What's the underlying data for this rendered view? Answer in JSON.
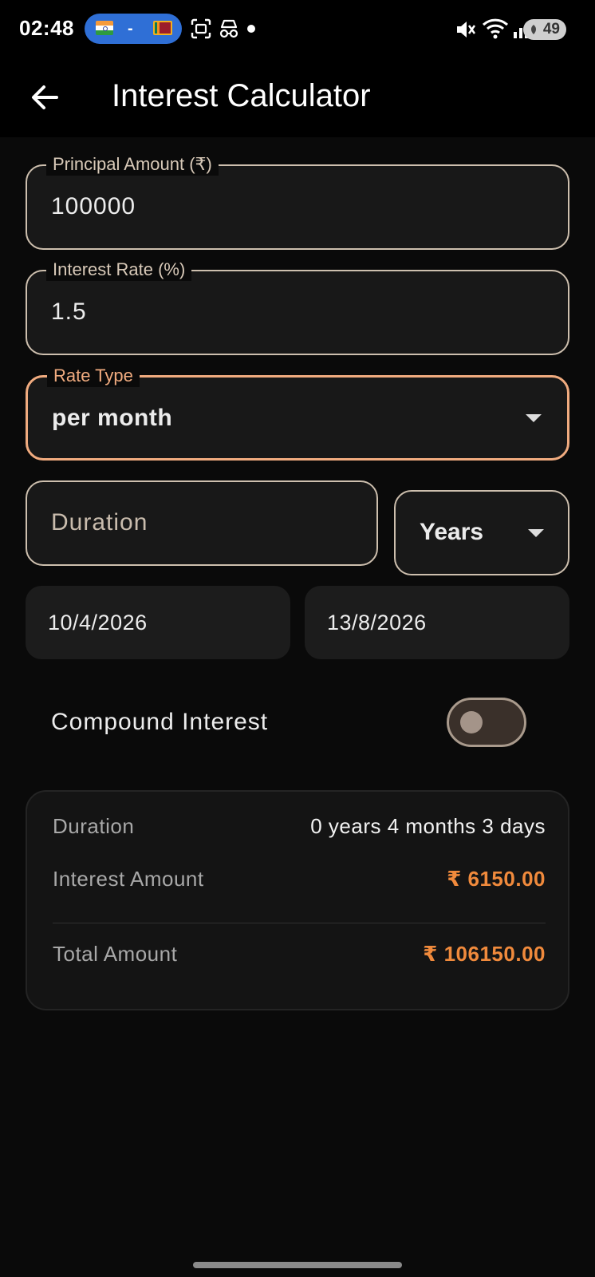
{
  "status_bar": {
    "time": "02:48",
    "battery": "49"
  },
  "app_bar": {
    "title": "Interest Calculator",
    "back_icon": "arrow-left-icon"
  },
  "form": {
    "principal": {
      "label": "Principal Amount (₹)",
      "value": "100000"
    },
    "rate": {
      "label": "Interest Rate (%)",
      "value": "1.5"
    },
    "rate_type": {
      "label": "Rate Type",
      "value": "per month"
    },
    "duration": {
      "placeholder": "Duration",
      "unit": "Years"
    },
    "start_date": "10/4/2026",
    "end_date": "13/8/2026",
    "compound": {
      "label": "Compound Interest",
      "enabled": false
    }
  },
  "results": {
    "duration": {
      "label": "Duration",
      "value": "0 years 4 months 3 days"
    },
    "interest": {
      "label": "Interest Amount",
      "value": "₹ 6150.00"
    },
    "total": {
      "label": "Total Amount",
      "value": "₹ 106150.00"
    }
  },
  "colors": {
    "accent": "#f08a3c",
    "focus_border": "#f0ab7f",
    "background": "#0a0a0a"
  }
}
